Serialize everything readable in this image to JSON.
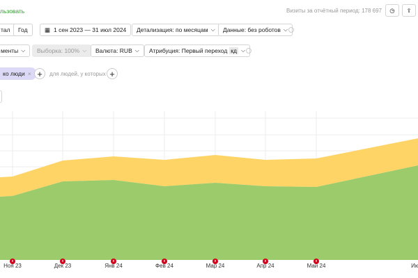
{
  "header": {
    "link": "льзовать",
    "visits_label": "Визиты за отчётный период: 178 697"
  },
  "period_buttons": [
    "тал",
    "Год"
  ],
  "date_range": "1 сен 2023 — 31 июл 2024",
  "detail": "Детализация: по месяцам",
  "data_filter": "Данные: без роботов",
  "segments": "менты",
  "sample": "Выборка: 100%",
  "currency": "Валюта: RUB",
  "attribution": "Атрибуция: Первый переход",
  "attribution_badge": "кд",
  "filter_chip": "ко люди",
  "people_label": "для людей, у которых",
  "colors": {
    "green": "#9bcb6a",
    "yellow": "#fed466",
    "accent": "#2c9c2c"
  },
  "chart_data": {
    "type": "area",
    "stacked": true,
    "categories": [
      "Ноя 23",
      "Дек 23",
      "Янв 24",
      "Фев 24",
      "Мар 24",
      "Апр 24",
      "Май 24",
      "Ию"
    ],
    "series": [
      {
        "name": "green",
        "values": [
          92,
          113,
          115,
          106,
          111,
          106,
          105,
          136
        ]
      },
      {
        "name": "yellow",
        "values": [
          28,
          30,
          34,
          38,
          40,
          38,
          41,
          39
        ]
      }
    ],
    "grid": true
  }
}
